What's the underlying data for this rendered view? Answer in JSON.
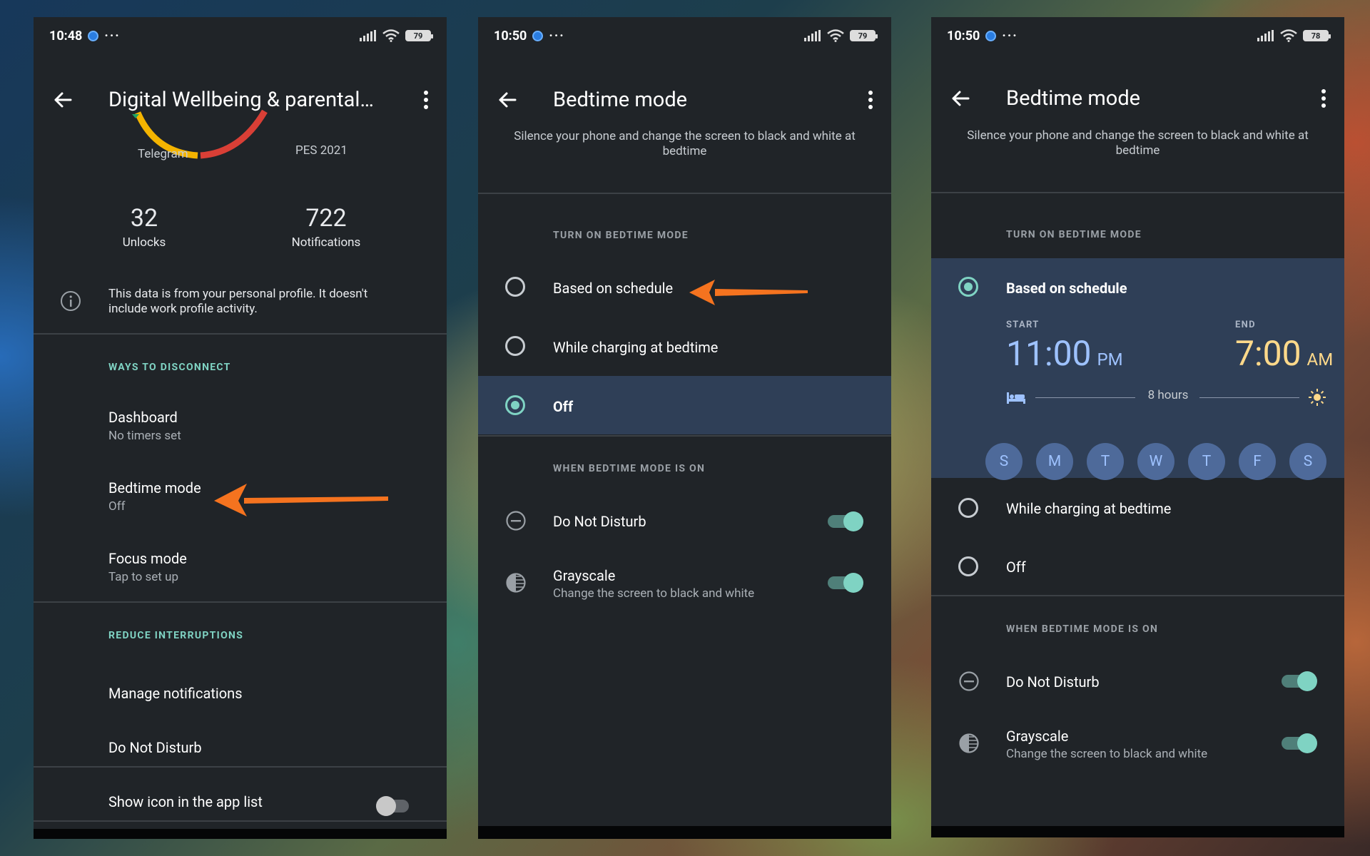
{
  "screen1": {
    "status": {
      "time": "10:48",
      "dots": "···",
      "battery": "79"
    },
    "title": "Digital Wellbeing & parental…",
    "chart_labels": {
      "left": "Telegram",
      "right": "PES 2021"
    },
    "stats": [
      {
        "value": "32",
        "label": "Unlocks"
      },
      {
        "value": "722",
        "label": "Notifications"
      }
    ],
    "info_text": "This data is from your personal profile. It doesn't include work profile activity.",
    "ways_header": "WAYS TO DISCONNECT",
    "ways_items": [
      {
        "title": "Dashboard",
        "subtitle": "No timers set"
      },
      {
        "title": "Bedtime mode",
        "subtitle": "Off"
      },
      {
        "title": "Focus mode",
        "subtitle": "Tap to set up"
      }
    ],
    "reduce_header": "REDUCE INTERRUPTIONS",
    "reduce_items": [
      "Manage notifications",
      "Do Not Disturb"
    ],
    "show_icon_label": "Show icon in the app list",
    "show_icon_on": false
  },
  "screen2": {
    "status": {
      "time": "10:50",
      "dots": "···",
      "battery": "79"
    },
    "title": "Bedtime mode",
    "description": "Silence your phone and change the screen to black and white at bedtime",
    "turn_on_header": "TURN ON BEDTIME MODE",
    "options": [
      "Based on schedule",
      "While charging at bedtime",
      "Off"
    ],
    "selected": "Off",
    "when_on_header": "WHEN BEDTIME MODE IS ON",
    "dnd_label": "Do Not Disturb",
    "dnd_on": true,
    "grayscale_label": "Grayscale",
    "grayscale_sub": "Change the screen to black and white",
    "grayscale_on": true
  },
  "screen3": {
    "status": {
      "time": "10:50",
      "dots": "···",
      "battery": "78"
    },
    "title": "Bedtime mode",
    "description": "Silence your phone and change the screen to black and white at bedtime",
    "turn_on_header": "TURN ON BEDTIME MODE",
    "options": [
      "Based on schedule",
      "While charging at bedtime",
      "Off"
    ],
    "selected": "Based on schedule",
    "schedule": {
      "start_label": "START",
      "start_time": "11:00",
      "start_ampm": "PM",
      "end_label": "END",
      "end_time": "7:00",
      "end_ampm": "AM",
      "duration": "8 hours",
      "days": [
        "S",
        "M",
        "T",
        "W",
        "T",
        "F",
        "S"
      ]
    },
    "when_on_header": "WHEN BEDTIME MODE IS ON",
    "dnd_label": "Do Not Disturb",
    "dnd_on": true,
    "grayscale_label": "Grayscale",
    "grayscale_sub": "Change the screen to black and white",
    "grayscale_on": true
  },
  "colors": {
    "accent_teal": "#7fd3c3",
    "annotation_arrow": "#f5731f",
    "start_time_blue": "#9ec2ff",
    "end_time_yellow": "#ffd98a",
    "selected_row": "#2f3f57"
  }
}
